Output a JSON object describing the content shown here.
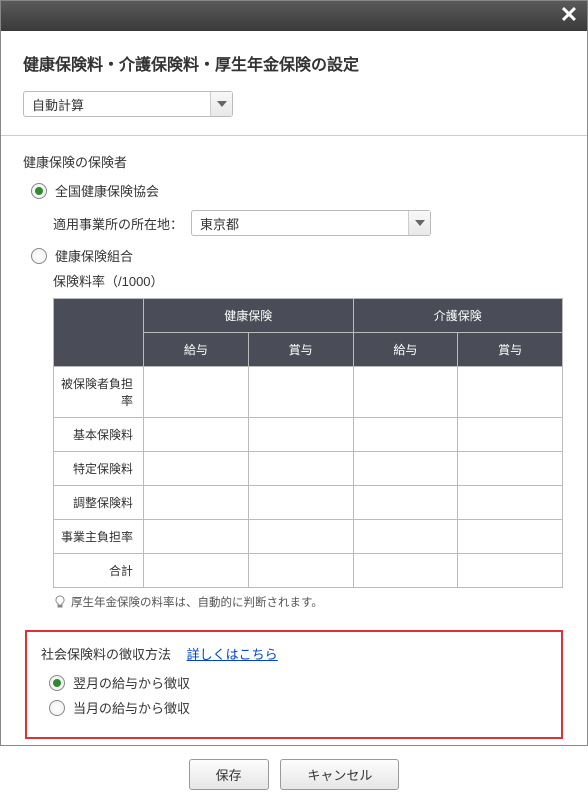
{
  "title": "健康保険料・介護保険料・厚生年金保険の設定",
  "calcMode": {
    "selected": "自動計算"
  },
  "section1": {
    "heading": "健康保険の保険者",
    "opt1": "全国健康保険協会",
    "officeLabel": "適用事業所の所在地：",
    "officeSelected": "東京都",
    "opt2": "健康保険組合",
    "rateLabel": "保険料率（/1000）",
    "tableHead": {
      "c1": "健康保険",
      "c2": "介護保険",
      "sub1": "給与",
      "sub2": "賞与",
      "sub3": "給与",
      "sub4": "賞与"
    },
    "rows": [
      "被保険者負担率",
      "基本保険料",
      "特定保険料",
      "調整保険料",
      "事業主負担率",
      "合計"
    ],
    "tip": "厚生年金保険の料率は、自動的に判断されます。"
  },
  "section2": {
    "heading": "社会保険料の徴収方法",
    "link": "詳しくはこちら",
    "opt1": "翌月の給与から徴収",
    "opt2": "当月の給与から徴収"
  },
  "buttons": {
    "save": "保存",
    "cancel": "キャンセル"
  }
}
